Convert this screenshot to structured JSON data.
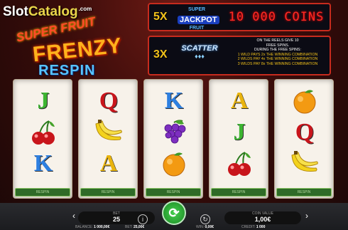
{
  "watermark": {
    "part1": "Slot",
    "part2": "Catalog",
    "suffix": ".com"
  },
  "logo": {
    "line1": "SUPER FRUIT",
    "line2": "FRENZY",
    "line3": "RESPIN"
  },
  "paytable": {
    "jackpot": {
      "multiplier": "5X",
      "logo_small_top": "SUPER",
      "logo_main": "JACKPOT",
      "logo_small_bottom": "FRUIT",
      "prize": "10 000 COINS"
    },
    "scatter": {
      "multiplier": "3X",
      "logo": "SCATTER",
      "logo_glyphs": "♦♦♦",
      "rules": [
        "ON THE REELS GIVE 10",
        "FREE SPINS.",
        "DURING THE FREE SPINS:",
        "1 WILD PAYS 2x THE WINNING COMBINATION",
        "2 WILDS PAY 4x THE WINNING COMBINATION",
        "3 WILDS PAY 8x THE WINNING COMBINATION"
      ]
    }
  },
  "reels": [
    {
      "symbols": [
        {
          "type": "J",
          "color": "#3db531"
        },
        {
          "type": "cherry",
          "color": "#c8151b"
        },
        {
          "type": "K",
          "color": "#2d7fe0"
        }
      ],
      "label": "RESPIN"
    },
    {
      "symbols": [
        {
          "type": "Q",
          "color": "#c8151b"
        },
        {
          "type": "banana",
          "color": "#f3d21c"
        },
        {
          "type": "A",
          "color": "#e9b40f"
        }
      ],
      "label": "RESPIN"
    },
    {
      "symbols": [
        {
          "type": "K",
          "color": "#2d7fe0"
        },
        {
          "type": "grapes",
          "color": "#7d2ec0"
        },
        {
          "type": "orange",
          "color": "#f39a12"
        }
      ],
      "label": "RESPIN"
    },
    {
      "symbols": [
        {
          "type": "A",
          "color": "#e9b40f"
        },
        {
          "type": "J",
          "color": "#3db531"
        },
        {
          "type": "cherry",
          "color": "#c8151b"
        }
      ],
      "label": "RESPIN"
    },
    {
      "symbols": [
        {
          "type": "orange",
          "color": "#f39a12"
        },
        {
          "type": "Q",
          "color": "#c8151b"
        },
        {
          "type": "banana",
          "color": "#f3d21c"
        }
      ],
      "label": "RESPIN"
    }
  ],
  "controls": {
    "bet_caption": "BET",
    "bet_value": "25",
    "coin_caption": "COIN VALUE",
    "coin_value": "1,00€",
    "spin_icon": "spin-arrows-icon",
    "info_icon": "info-icon",
    "autoplay_icon": "autoplay-icon"
  },
  "footer": {
    "balance_caption": "BALANCE:",
    "balance_value": "1 000,00€",
    "bet_caption": "BET:",
    "bet_value": "25,00€",
    "win_caption": "WIN:",
    "win_value": "0,00€",
    "credit_caption": "CREDIT:",
    "credit_value": "1 000"
  }
}
